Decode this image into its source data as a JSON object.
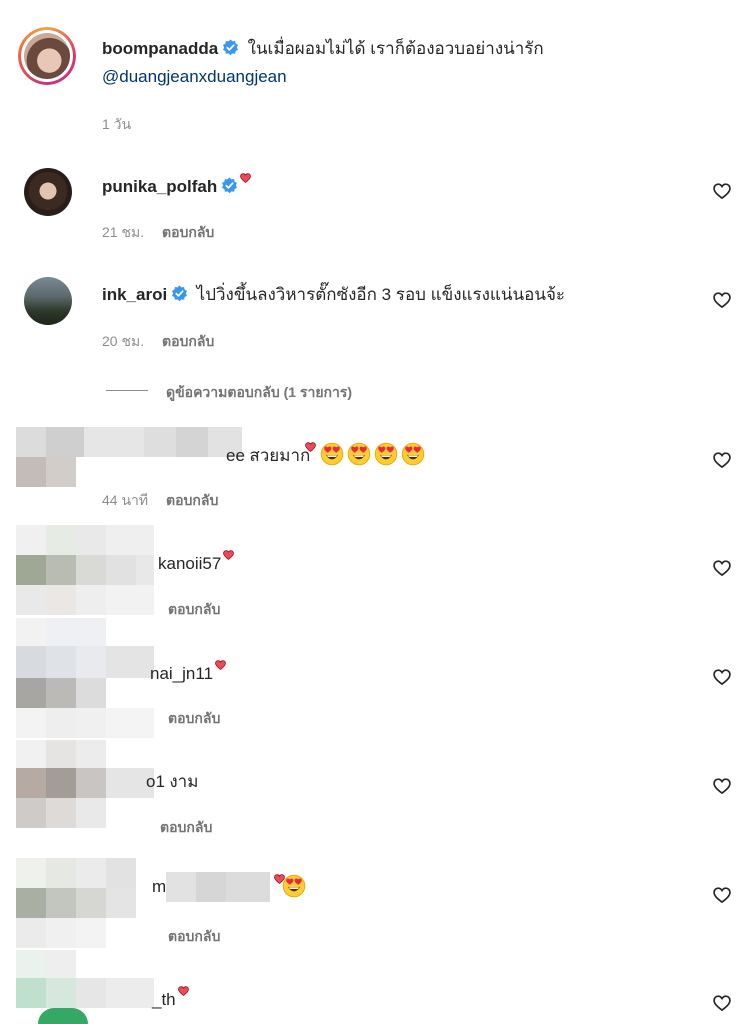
{
  "caption": {
    "username": "boompanadda",
    "text": "ในเมื่อผอมไม่ได้ เราก็ต้องอวบอย่างน่ารัก",
    "mention": "@duangjeanxduangjean",
    "time": "1 วัน"
  },
  "comments": [
    {
      "username": "punika_polfah",
      "text": "",
      "time": "21 ชม.",
      "reply": "ตอบกลับ"
    },
    {
      "username": "ink_aroi",
      "text": "ไปวิ่งขึ้นลงวิหารตั๊กซังอีก 3 รอบ แข็งแรงแน่นอนจ้ะ",
      "time": "20 ชม.",
      "reply": "ตอบกลับ"
    }
  ],
  "view_replies": "ดูข้อความตอบกลับ (1 รายการ)",
  "blurred_comments": [
    {
      "username_fragment": "ee",
      "text": "สวยมาก",
      "time": "44 นาที",
      "reply": "ตอบกลับ"
    },
    {
      "username_fragment": "kanoii57",
      "text": "",
      "time": "",
      "reply": "ตอบกลับ"
    },
    {
      "username_fragment": "nai_jn11",
      "text": "",
      "time": "",
      "reply": "ตอบกลับ"
    },
    {
      "username_fragment": "o1",
      "text": "งาม",
      "time": "",
      "reply": "ตอบกลับ"
    },
    {
      "username_fragment": "m",
      "text": "",
      "time": "",
      "reply": "ตอบกลับ"
    },
    {
      "username_fragment": "_th",
      "text": "",
      "time": "",
      "reply": ""
    }
  ],
  "colors": {
    "verified": "#3897f0",
    "heart": "#ed4956",
    "link": "#00376b",
    "muted": "#8e8e8e"
  }
}
